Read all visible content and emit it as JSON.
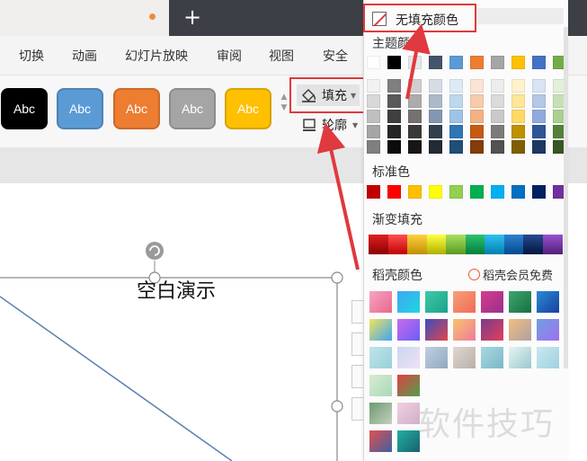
{
  "titlebar": {
    "new_tab_label": "+"
  },
  "menu": {
    "items": [
      "切换",
      "动画",
      "幻灯片放映",
      "审阅",
      "视图",
      "安全"
    ]
  },
  "ribbon": {
    "styles": [
      {
        "label": "Abc",
        "color": "#000000"
      },
      {
        "label": "Abc",
        "color": "#5b9bd5"
      },
      {
        "label": "Abc",
        "color": "#ed7d31"
      },
      {
        "label": "Abc",
        "color": "#a5a5a5"
      },
      {
        "label": "Abc",
        "color": "#ffc000"
      }
    ],
    "fill_label": "填充",
    "outline_label": "轮廓"
  },
  "slide": {
    "title": "空白演示"
  },
  "color_panel": {
    "no_fill_label": "无填充颜色",
    "theme_colors_label": "主题颜色",
    "standard_colors_label": "标准色",
    "gradient_fill_label": "渐变填充",
    "docer_colors_label": "稻壳颜色",
    "member_free_label": "稻壳会员免费",
    "theme_top_row": [
      "#ffffff",
      "#000000",
      "#e7e6e6",
      "#44546a",
      "#5b9bd5",
      "#ed7d31",
      "#a5a5a5",
      "#ffc000",
      "#4472c4",
      "#70ad47"
    ],
    "theme_shades": [
      [
        "#f2f2f2",
        "#7f7f7f",
        "#d0cece",
        "#d6dce4",
        "#deebf6",
        "#fbe4d5",
        "#ededed",
        "#fff2cc",
        "#dae3f3",
        "#e2efda"
      ],
      [
        "#d8d8d8",
        "#595959",
        "#aeabab",
        "#adb9ca",
        "#bdd7ee",
        "#f8cbad",
        "#dbdbdb",
        "#ffe699",
        "#b4c7e7",
        "#c6e0b4"
      ],
      [
        "#bfbfbf",
        "#3f3f3f",
        "#757171",
        "#8497b0",
        "#9dc3e6",
        "#f4b183",
        "#c9c9c9",
        "#ffd966",
        "#8faadc",
        "#a9d08e"
      ],
      [
        "#a5a5a5",
        "#262626",
        "#3a3838",
        "#323f4f",
        "#2e75b5",
        "#c55a11",
        "#7b7b7b",
        "#bf9000",
        "#2f5597",
        "#538135"
      ],
      [
        "#7f7f7f",
        "#0c0c0c",
        "#171616",
        "#222a35",
        "#1f4e79",
        "#843c0b",
        "#525252",
        "#7f6000",
        "#1f3864",
        "#375623"
      ]
    ],
    "standard_colors": [
      "#c00000",
      "#ff0000",
      "#ffc000",
      "#ffff00",
      "#92d050",
      "#00b050",
      "#00b0f0",
      "#0070c0",
      "#002060",
      "#7030a0"
    ],
    "gradient_colors": [
      [
        "#e02020",
        "#8a0000"
      ],
      [
        "#ff5050",
        "#c00000"
      ],
      [
        "#ffd040",
        "#c09000"
      ],
      [
        "#ffff40",
        "#b0b000"
      ],
      [
        "#a8e060",
        "#5a9a20"
      ],
      [
        "#30c070",
        "#00803a"
      ],
      [
        "#30c0f0",
        "#0080b0"
      ],
      [
        "#3080d0",
        "#004a90"
      ],
      [
        "#2a4a90",
        "#001540"
      ],
      [
        "#9a50d0",
        "#50207a"
      ]
    ],
    "docer_rows": [
      [
        [
          "#f6a5c0",
          "#e9678f"
        ],
        [
          "#3fa7f5",
          "#1fd5e0"
        ],
        [
          "#3ec9a7",
          "#1aa38a"
        ],
        [
          "#f7a07a",
          "#f06b55"
        ],
        [
          "#d63e8c",
          "#9a2e8e"
        ],
        [
          "#3aa76d",
          "#1b6e44"
        ],
        [
          "#2a8bd6",
          "#173f9e"
        ]
      ],
      [
        [
          "#f3e35b",
          "#3ba6f3"
        ],
        [
          "#c86bf0",
          "#6a5ef2"
        ],
        [
          "#3a4ec0",
          "#e0454b"
        ],
        [
          "#f8c46b",
          "#f07a9a"
        ],
        [
          "#7a3b8c",
          "#e0405a"
        ],
        [
          "#f0c080",
          "#b0a0a0"
        ],
        [
          "#6fa0e0",
          "#a070f0"
        ]
      ],
      [
        [
          "#bfe4ea",
          "#9ad0d8"
        ],
        [
          "#c8d8f0",
          "#f0e0f8"
        ],
        [
          "#c0d0e0",
          "#90a8c0"
        ],
        [
          "#e0d8d0",
          "#b8b0a8"
        ],
        [
          "#a8d8e0",
          "#7ab8c8"
        ],
        [
          "#e8f4f0",
          "#9ac8d0"
        ],
        [
          "#c8e8f0",
          "#a0d0e0"
        ]
      ],
      [
        [
          "#d8ecd0",
          "#a8d8b8"
        ],
        [
          "#e04040",
          "#50a050"
        ],
        [
          "#ffffff",
          "#ffffff"
        ],
        [
          "#ffffff",
          "#ffffff"
        ],
        [
          "#ffffff",
          "#ffffff"
        ],
        [
          "#ffffff",
          "#ffffff"
        ],
        [
          "#ffffff",
          "#ffffff"
        ]
      ],
      [
        [
          "#6a9a70",
          "#c8d0c0"
        ],
        [
          "#f0d0e0",
          "#d0b0c8"
        ],
        [
          "#ffffff",
          "#ffffff"
        ],
        [
          "#ffffff",
          "#ffffff"
        ],
        [
          "#ffffff",
          "#ffffff"
        ],
        [
          "#ffffff",
          "#ffffff"
        ],
        [
          "#ffffff",
          "#ffffff"
        ]
      ],
      [
        [
          "#e05050",
          "#4060a0"
        ],
        [
          "#20b0a0",
          "#1a6070"
        ],
        [
          "#ffffff",
          "#ffffff"
        ],
        [
          "#ffffff",
          "#ffffff"
        ],
        [
          "#ffffff",
          "#ffffff"
        ],
        [
          "#ffffff",
          "#ffffff"
        ],
        [
          "#ffffff",
          "#ffffff"
        ]
      ]
    ]
  },
  "watermark": "软件技巧",
  "colors": {
    "highlight_red": "#e0393e",
    "accent_orange": "#f08b3a"
  }
}
